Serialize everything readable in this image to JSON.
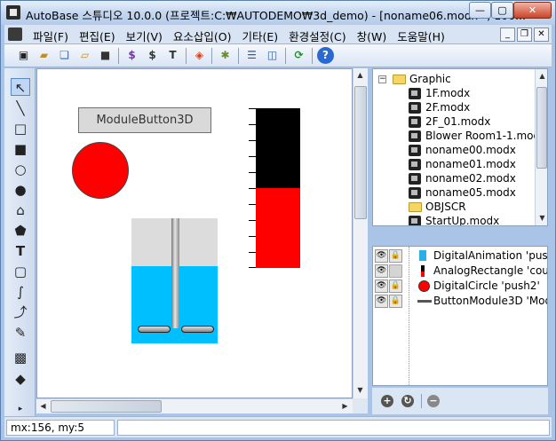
{
  "window": {
    "title": "AutoBase 스튜디오 10.0.0 (프로젝트:C:₩AUTODEMO₩3d_demo) - [noname06.modx *, 100..."
  },
  "menu": {
    "items": [
      "파일(F)",
      "편집(E)",
      "보기(V)",
      "요소삽입(O)",
      "기타(E)",
      "환경설정(C)",
      "창(W)",
      "도움말(H)"
    ]
  },
  "canvas": {
    "module_button_label": "ModuleButton3D",
    "gauge_level": 0.5,
    "tank_level": 0.62
  },
  "tree": {
    "root": "Graphic",
    "files": [
      "1F.modx",
      "2F.modx",
      "2F_01.modx",
      "Blower Room1-1.mod",
      "noname00.modx",
      "noname01.modx",
      "noname02.modx",
      "noname05.modx"
    ],
    "folder2": "OBJSCR",
    "last_file": "StartUp.modx"
  },
  "layers": {
    "items": [
      {
        "label": "DigitalAnimation 'push"
      },
      {
        "label": "AnalogRectangle 'cour"
      },
      {
        "label": "DigitalCircle 'push2'"
      },
      {
        "label": "ButtonModule3D 'Modu"
      }
    ]
  },
  "status": {
    "coords": "mx:156, my:5"
  },
  "colors": {
    "accent_red": "#ff0000",
    "tank_water": "#00bfff",
    "chrome_blue": "#a9c4e6"
  }
}
